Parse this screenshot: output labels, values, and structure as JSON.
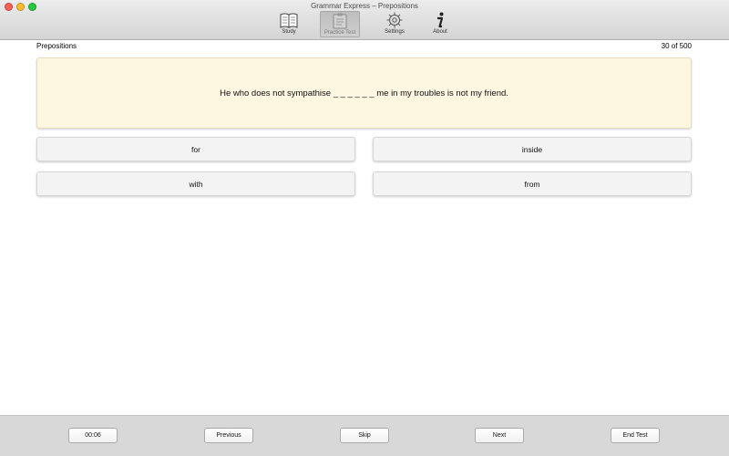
{
  "window": {
    "title": "Grammar Express – Prepositions"
  },
  "toolbar": {
    "items": [
      {
        "label": "Study",
        "icon": "book-icon"
      },
      {
        "label": "Practice Test",
        "icon": "clipboard-icon",
        "active": true
      },
      {
        "label": "Settings",
        "icon": "gear-icon"
      },
      {
        "label": "About",
        "icon": "info-icon"
      }
    ]
  },
  "main": {
    "section_title": "Prepositions",
    "progress_text": "30 of 500",
    "question": "He who does not sympathise _ _ _ _ _ _ me in my troubles is not my friend.",
    "answers": [
      "for",
      "inside",
      "with",
      "from"
    ]
  },
  "footer": {
    "timer": "00:06",
    "previous_label": "Previous",
    "skip_label": "Skip",
    "next_label": "Next",
    "end_label": "End Test"
  },
  "colors": {
    "question_bg": "#fdf6e1",
    "answer_bg": "#f3f3f3",
    "bottombar_bg": "#d8d8d8"
  }
}
